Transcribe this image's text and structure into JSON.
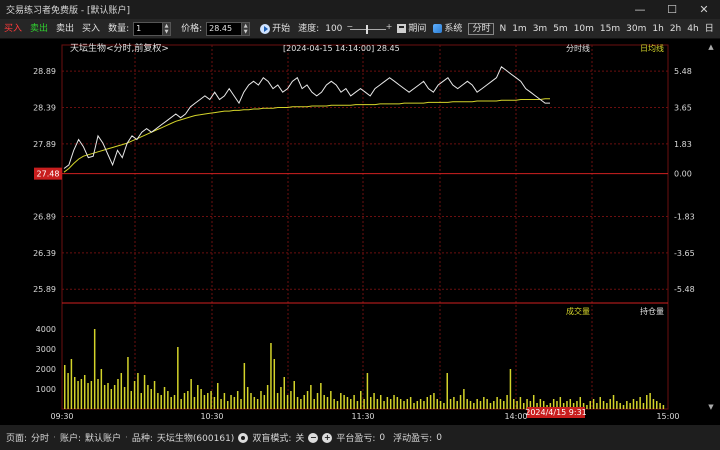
{
  "window": {
    "title": "交易练习者免费版 - [默认账户]",
    "minimize": "—",
    "maximize": "☐",
    "close": "✕"
  },
  "toolbar": {
    "buy": "买入",
    "sell": "卖出",
    "sell2": "卖出",
    "buy2": "买入",
    "qty_label": "数量:",
    "qty_value": "1",
    "price_label": "价格:",
    "price_value": "28.45",
    "start": "开始",
    "speed_label": "速度:",
    "speed_value": "100",
    "period": "期间",
    "system": "系统",
    "periods": [
      "分时",
      "N",
      "1m",
      "3m",
      "5m",
      "10m",
      "15m",
      "30m",
      "1h",
      "2h",
      "4h",
      "日"
    ],
    "selected_period": "分时"
  },
  "chart": {
    "stock_title": "天坛生物<分时,前复权>",
    "cursor_info": "[2024-04-15 14:14:00]   28.45",
    "legend_price": "分时线",
    "legend_avg": "日均线",
    "legend_volume": "成交量",
    "legend_oi": "持仓量",
    "current_price_tag": "27.48",
    "time_tag": "2024/4/15 9:31",
    "colors": {
      "price_line": "#e8e8e8",
      "avg_line": "#d4d42a",
      "volume": "#d4d42a",
      "grid": "#6b0f0f",
      "prev_close": "#d02020",
      "price_axis": "#d8d8d8",
      "pct_axis": "#d8d8d8"
    }
  },
  "chart_data": {
    "type": "line",
    "price_axis": [
      "28.89",
      "28.39",
      "27.89",
      "27.48",
      "26.89",
      "26.39",
      "25.89"
    ],
    "percent_axis": [
      "5.48",
      "3.65",
      "1.83",
      "0.00",
      "-1.83",
      "-3.65",
      "-5.48"
    ],
    "volume_axis": [
      "4000",
      "3000",
      "2000",
      "1000"
    ],
    "time_axis": [
      "09:30",
      "10:30",
      "11:30",
      "14:00",
      "15:00"
    ],
    "ylim": [
      25.7,
      29.25
    ],
    "prev_close": 27.48,
    "volume_ylim": [
      0,
      4600
    ],
    "series": [
      {
        "name": "分时线",
        "values": [
          27.55,
          27.6,
          27.8,
          27.95,
          27.85,
          27.7,
          27.72,
          28.0,
          27.9,
          27.75,
          27.6,
          27.8,
          27.7,
          27.9,
          28.0,
          27.95,
          28.05,
          28.1,
          28.05,
          28.1,
          28.15,
          28.2,
          28.25,
          28.3,
          28.25,
          28.3,
          28.4,
          28.45,
          28.5,
          28.55,
          28.5,
          28.6,
          28.5,
          28.55,
          28.65,
          28.55,
          28.45,
          28.6,
          28.7,
          28.75,
          28.7,
          28.8,
          28.75,
          28.65,
          28.7,
          28.6,
          28.65,
          28.75,
          28.8,
          28.65,
          28.7,
          28.6,
          28.55,
          28.6,
          28.7,
          28.75,
          28.7,
          28.6,
          28.65,
          28.55,
          28.6,
          28.65,
          28.6,
          28.55,
          28.65,
          28.7,
          28.75,
          28.8,
          28.75,
          28.7,
          28.65,
          28.6,
          28.65,
          28.7,
          28.75,
          28.65,
          28.6,
          28.7,
          28.75,
          28.8,
          28.7,
          28.65,
          28.7,
          28.75,
          28.7,
          28.6,
          28.65,
          28.7,
          28.75,
          28.8,
          28.95,
          28.9,
          28.85,
          28.8,
          28.75,
          28.65,
          28.6,
          28.55,
          28.5,
          28.45,
          28.45
        ]
      },
      {
        "name": "日均线",
        "values": [
          27.5,
          27.55,
          27.62,
          27.68,
          27.72,
          27.74,
          27.76,
          27.78,
          27.8,
          27.82,
          27.84,
          27.86,
          27.88,
          27.9,
          27.93,
          27.96,
          27.99,
          28.02,
          28.05,
          28.08,
          28.11,
          28.14,
          28.17,
          28.2,
          28.22,
          28.24,
          28.26,
          28.28,
          28.29,
          28.3,
          28.31,
          28.32,
          28.33,
          28.34,
          28.34,
          28.35,
          28.35,
          28.36,
          28.36,
          28.37,
          28.37,
          28.38,
          28.38,
          28.38,
          28.39,
          28.39,
          28.39,
          28.4,
          28.4,
          28.4,
          28.4,
          28.41,
          28.41,
          28.41,
          28.41,
          28.42,
          28.42,
          28.42,
          28.42,
          28.42,
          28.43,
          28.43,
          28.43,
          28.43,
          28.43,
          28.44,
          28.44,
          28.44,
          28.44,
          28.44,
          28.45,
          28.45,
          28.45,
          28.45,
          28.45,
          28.46,
          28.46,
          28.46,
          28.46,
          28.46,
          28.47,
          28.47,
          28.47,
          28.47,
          28.47,
          28.48,
          28.48,
          28.48,
          28.48,
          28.48,
          28.49,
          28.49,
          28.49,
          28.49,
          28.5,
          28.5,
          28.5,
          28.5,
          28.5,
          28.51,
          28.51
        ]
      }
    ],
    "volume": [
      2200,
      1800,
      2500,
      1600,
      1400,
      1500,
      1700,
      1300,
      1400,
      4000,
      1500,
      2000,
      1200,
      1300,
      1000,
      1200,
      1500,
      1800,
      1100,
      2600,
      900,
      1400,
      1800,
      800,
      1700,
      1200,
      1000,
      1400,
      800,
      700,
      1100,
      900,
      600,
      700,
      3100,
      500,
      800,
      900,
      1500,
      600,
      1200,
      1000,
      700,
      800,
      900,
      600,
      1300,
      500,
      800,
      400,
      700,
      600,
      900,
      500,
      2300,
      1100,
      800,
      600,
      500,
      900,
      700,
      1200,
      3300,
      2500,
      800,
      1100,
      1600,
      700,
      900,
      1400,
      600,
      500,
      700,
      900,
      1200,
      500,
      800,
      1300,
      700,
      600,
      900,
      500,
      400,
      800,
      700,
      600,
      500,
      700,
      400,
      900,
      500,
      1800,
      600,
      800,
      500,
      700,
      400,
      600,
      500,
      700,
      600,
      500,
      400,
      500,
      600,
      300,
      400,
      500,
      400,
      600,
      700,
      800,
      500,
      400,
      300,
      1800,
      500,
      600,
      400,
      700,
      1000,
      500,
      400,
      300,
      500,
      400,
      600,
      500,
      300,
      400,
      600,
      500,
      400,
      700,
      2000,
      500,
      400,
      600,
      300,
      500,
      400,
      700,
      300,
      500,
      400,
      200,
      300,
      500,
      400,
      600,
      300,
      400,
      500,
      300,
      400,
      600,
      300,
      200,
      400,
      500,
      300,
      600,
      400,
      300,
      500,
      700,
      400,
      300,
      200,
      400,
      300,
      500,
      400,
      600,
      300,
      700,
      800,
      500,
      400,
      300,
      200
    ]
  },
  "statusbar": {
    "page_label": "页面:",
    "page_value": "分时",
    "account_label": "账户:",
    "account_value": "默认账户",
    "symbol_label": "品种:",
    "symbol_value": "天坛生物(600161)",
    "blind_label": "双盲模式:",
    "blind_value": "关",
    "close_pnl_label": "平台盈亏:",
    "close_pnl_value": "0",
    "float_pnl_label": "浮动盈亏:",
    "float_pnl_value": "0",
    "minus": "−",
    "plus": "+"
  }
}
